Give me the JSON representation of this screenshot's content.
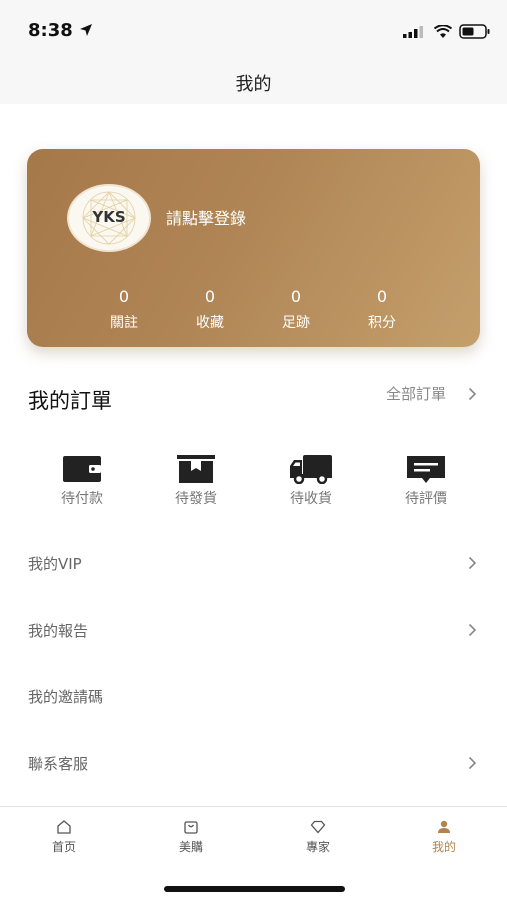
{
  "status_bar": {
    "time": "8:38"
  },
  "nav": {
    "title": "我的"
  },
  "profile": {
    "logo_text": "YKS",
    "login_prompt": "請點擊登錄",
    "stats": [
      {
        "value": "0",
        "label": "關註"
      },
      {
        "value": "0",
        "label": "收藏"
      },
      {
        "value": "0",
        "label": "足跡"
      },
      {
        "value": "0",
        "label": "积分"
      }
    ]
  },
  "orders": {
    "title": "我的訂單",
    "all_label": "全部訂單",
    "items": [
      {
        "label": "待付款",
        "icon": "wallet-icon"
      },
      {
        "label": "待發貨",
        "icon": "package-icon"
      },
      {
        "label": "待收貨",
        "icon": "truck-icon"
      },
      {
        "label": "待評價",
        "icon": "review-icon"
      }
    ]
  },
  "menu": [
    {
      "label": "我的VIP",
      "has_arrow": true
    },
    {
      "label": "我的報告",
      "has_arrow": true
    },
    {
      "label": "我的邀請碼",
      "has_arrow": false
    },
    {
      "label": "聯系客服",
      "has_arrow": true
    }
  ],
  "tabs": [
    {
      "label": "首页",
      "icon": "home-icon",
      "active": false
    },
    {
      "label": "美購",
      "icon": "shopping-bag-icon",
      "active": false
    },
    {
      "label": "專家",
      "icon": "diamond-icon",
      "active": false
    },
    {
      "label": "我的",
      "icon": "person-icon",
      "active": true
    }
  ],
  "colors": {
    "accent": "#b0844e",
    "card_start": "#a5784a",
    "card_end": "#c49f6c"
  }
}
